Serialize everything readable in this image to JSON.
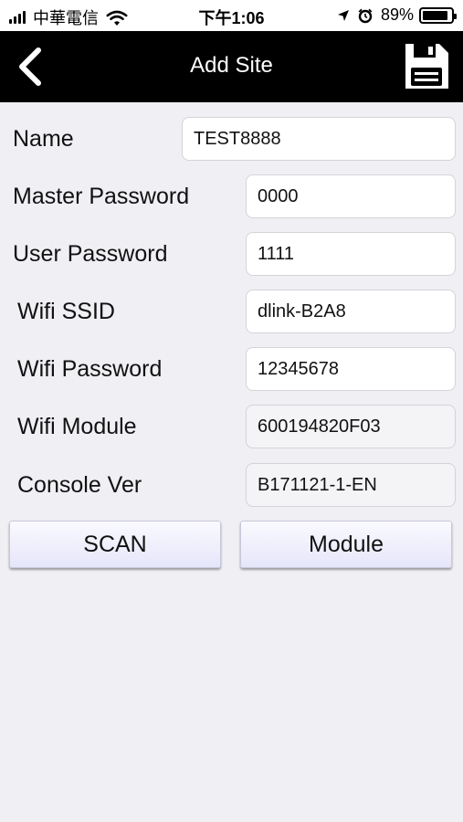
{
  "status_bar": {
    "carrier": "中華電信",
    "time": "下午1:06",
    "battery_percent": "89%",
    "battery_level": 0.89
  },
  "nav": {
    "title": "Add Site"
  },
  "form": {
    "name": {
      "label": "Name",
      "value": "TEST8888"
    },
    "master_password": {
      "label": "Master Password",
      "value": "0000"
    },
    "user_password": {
      "label": "User Password",
      "value": "1111"
    },
    "wifi_ssid": {
      "label": "Wifi SSID",
      "value": "dlink-B2A8"
    },
    "wifi_password": {
      "label": "Wifi Password",
      "value": "12345678"
    },
    "wifi_module": {
      "label": "Wifi Module",
      "value": "600194820F03"
    },
    "console_ver": {
      "label": "Console Ver",
      "value": "B171121-1-EN"
    }
  },
  "buttons": {
    "scan": "SCAN",
    "module": "Module"
  },
  "colors": {
    "nav_background": "#000000",
    "page_background": "#efeff4",
    "button_gradient_top": "#fafaff",
    "button_gradient_bottom": "#e6e6fa"
  }
}
